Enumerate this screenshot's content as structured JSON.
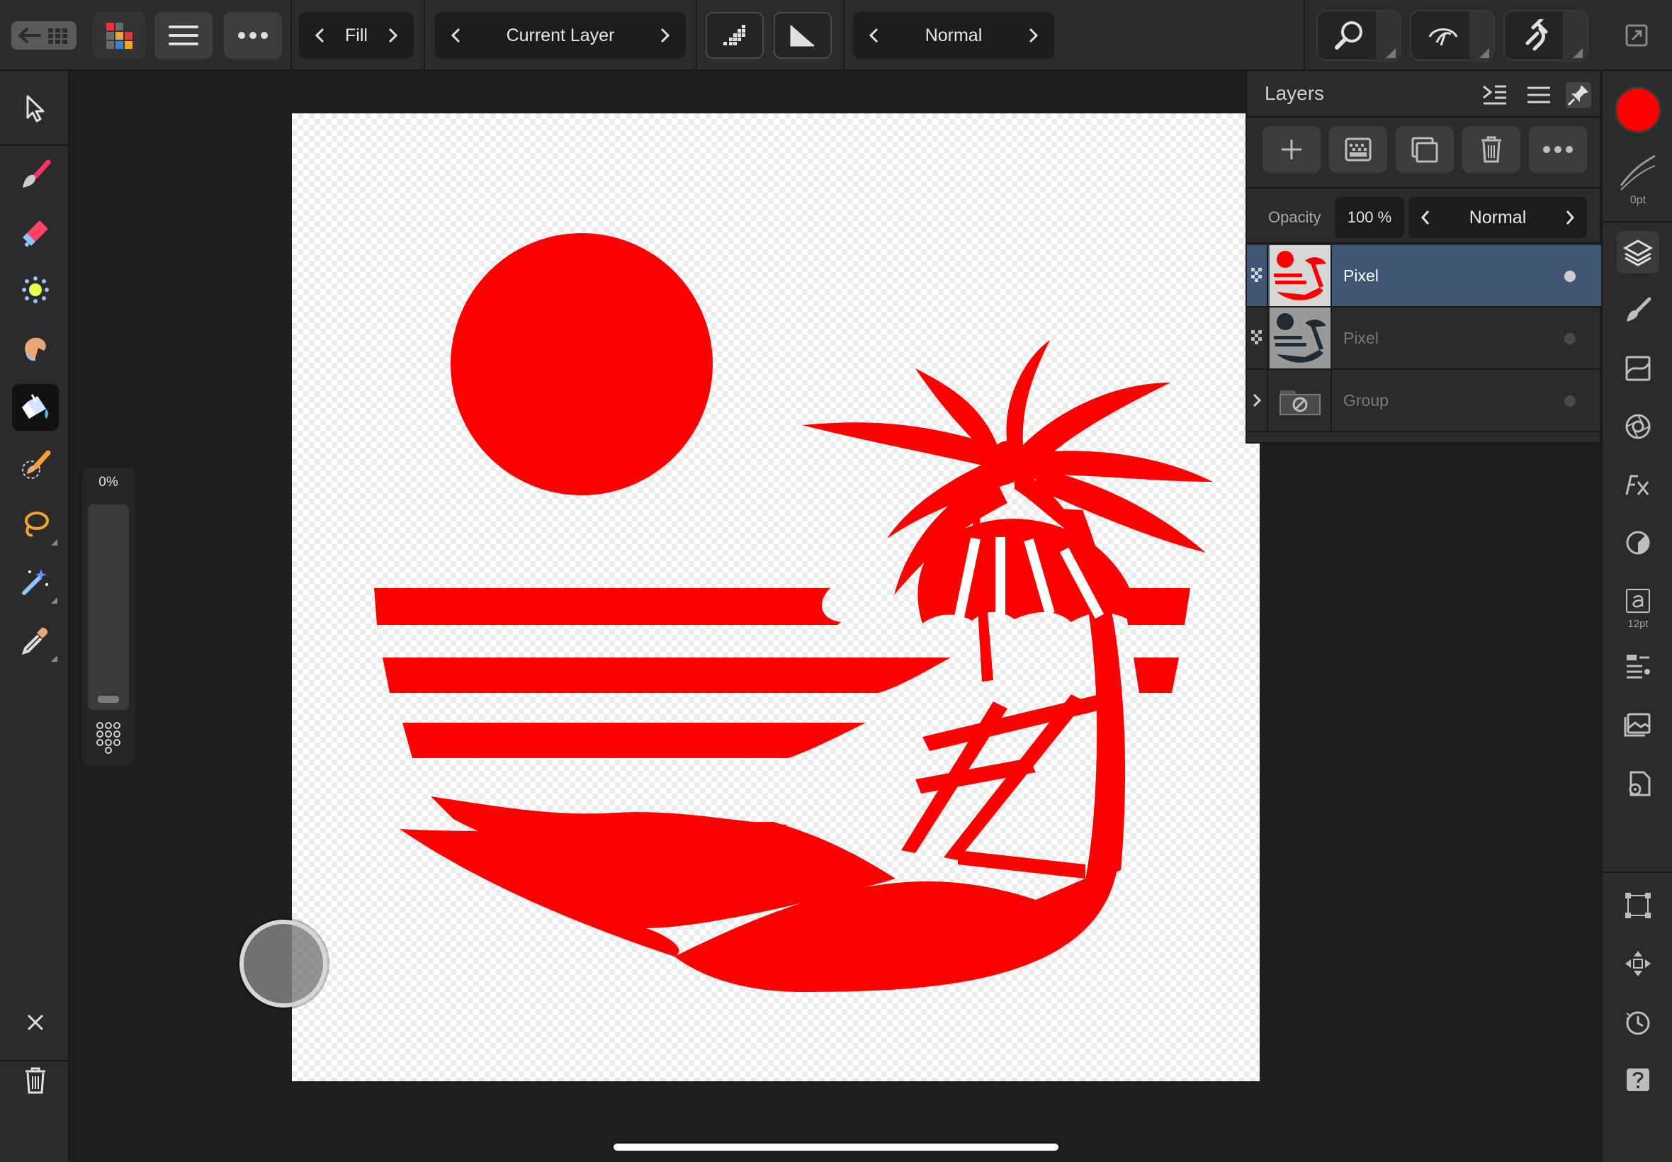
{
  "toolbar": {
    "fill_label": "Fill",
    "source_label": "Current Layer",
    "blend_label": "Normal"
  },
  "layers_panel": {
    "title": "Layers",
    "opacity_label": "Opacity",
    "opacity_value": "100 %",
    "blend_mode": "Normal",
    "rows": [
      {
        "name": "Pixel",
        "selected": true
      },
      {
        "name": "Pixel",
        "selected": false
      },
      {
        "name": "Group",
        "selected": false
      }
    ]
  },
  "left_panel": {
    "slider_value": "0%"
  },
  "right_panel": {
    "stroke_width": "0pt",
    "text_size": "12pt",
    "primary_color": "#ff0000"
  },
  "colors": {
    "artwork": "#ff0000",
    "selection": "#3f5674",
    "panel": "#2b2b2b"
  }
}
